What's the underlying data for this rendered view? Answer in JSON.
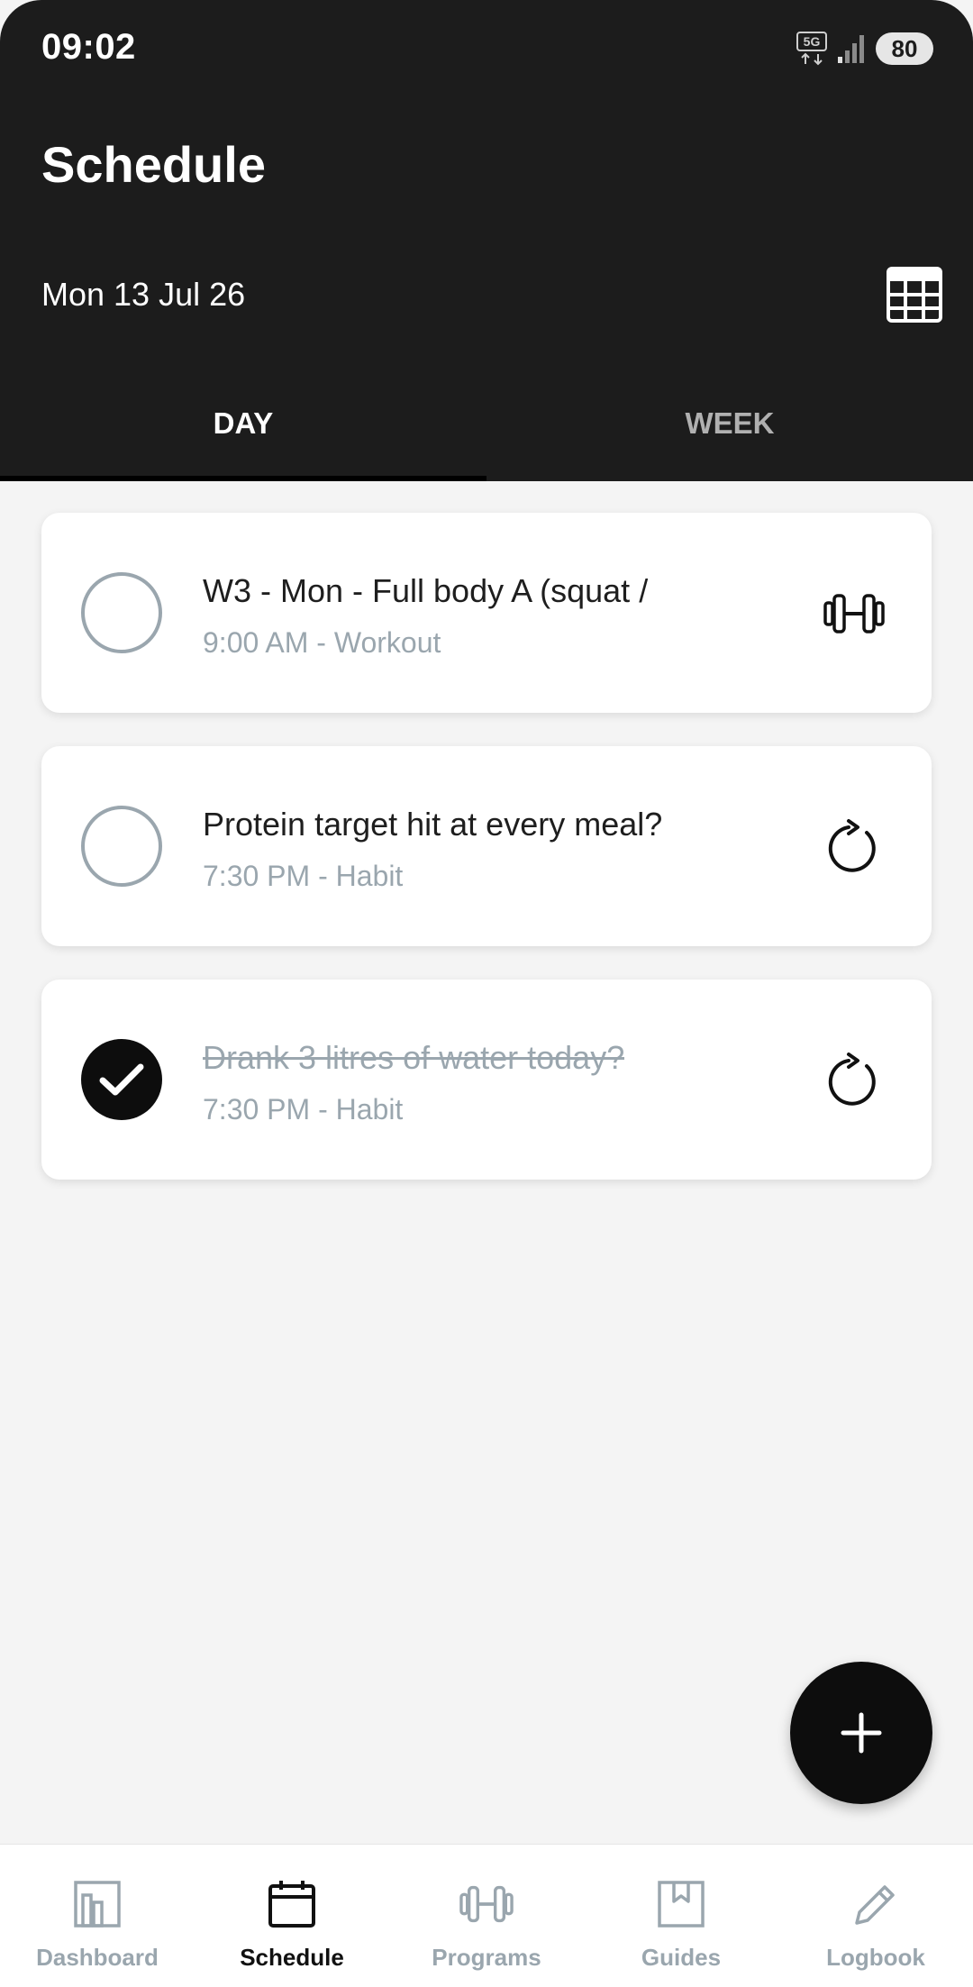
{
  "status_bar": {
    "time": "09:02",
    "network": "5G",
    "battery": "80"
  },
  "header": {
    "title": "Schedule",
    "date": "Mon 13 Jul 26",
    "calendar_icon": "calendar-grid-icon"
  },
  "tabs": [
    {
      "label": "DAY",
      "selected": true
    },
    {
      "label": "WEEK",
      "selected": false
    }
  ],
  "items": [
    {
      "title": "W3 - Mon - Full body A (squat /",
      "subtitle": "9:00 AM - Workout",
      "completed": false,
      "icon": "dumbbell-icon"
    },
    {
      "title": "Protein target hit at every meal?",
      "subtitle": "7:30 PM - Habit",
      "completed": false,
      "icon": "repeat-icon"
    },
    {
      "title": "Drank 3 litres of water today?",
      "subtitle": "7:30 PM - Habit",
      "completed": true,
      "icon": "repeat-icon"
    }
  ],
  "fab": {
    "icon": "plus-icon"
  },
  "bottom_nav": [
    {
      "label": "Dashboard",
      "icon": "dashboard-icon",
      "active": false
    },
    {
      "label": "Schedule",
      "icon": "calendar-icon",
      "active": true
    },
    {
      "label": "Programs",
      "icon": "dumbbell-icon",
      "active": false
    },
    {
      "label": "Guides",
      "icon": "bookmark-icon",
      "active": false
    },
    {
      "label": "Logbook",
      "icon": "pencil-icon",
      "active": false
    }
  ],
  "colors": {
    "header_bg": "#1c1c1c",
    "page_bg": "#f4f4f4",
    "accent": "#0d0d0d",
    "muted": "#9aa6ae"
  }
}
